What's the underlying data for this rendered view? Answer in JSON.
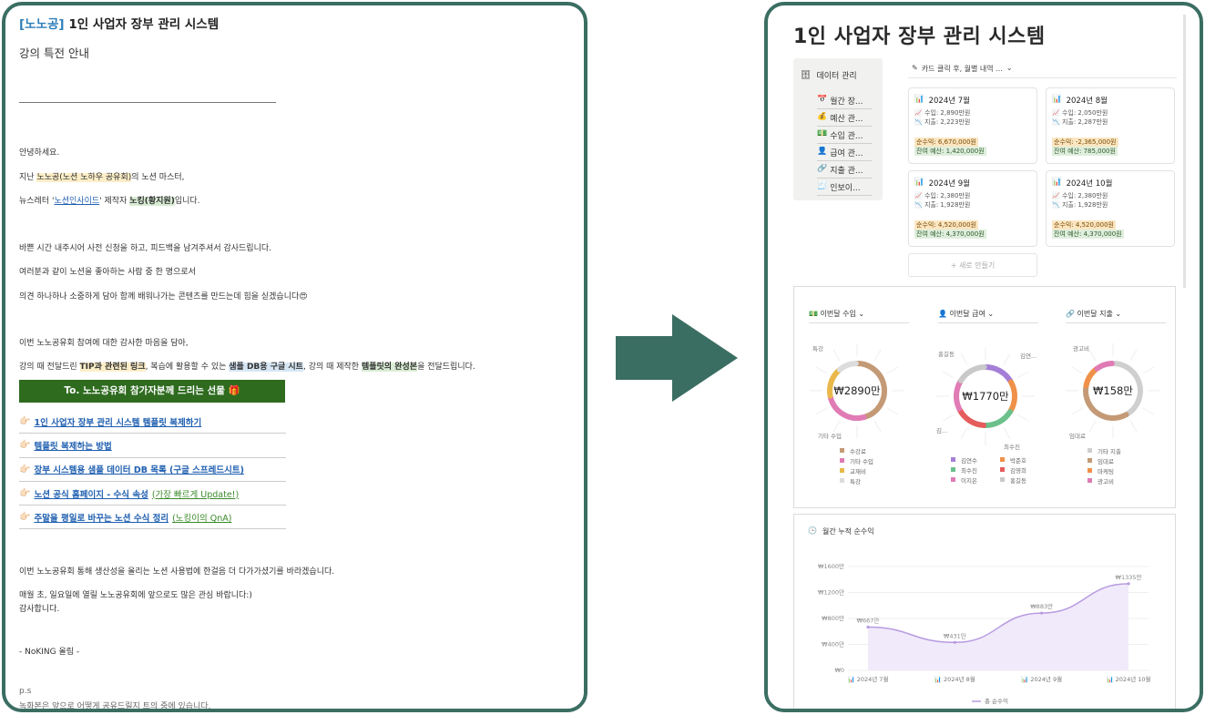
{
  "email": {
    "tag": "[노노공]",
    "title": "1인 사업자 장부 관리 시스템",
    "subtitle": "강의 특전 안내",
    "greeting": "안녕하세요.",
    "line1_pre": "지난 ",
    "line1_hl": "노노공(노션 노하우 공유회)",
    "line1_post": "의 노션 마스터,",
    "line2_pre": "뉴스레터 '",
    "line2_link": "노션인사이드",
    "line2_mid": "' 제작자 ",
    "line2_hl": "노킹(황지원)",
    "line2_post": "입니다.",
    "para1": "바쁜 시간 내주시어 사전 신청을 하고, 피드백을 남겨주셔서 감사드립니다.",
    "para2": "여러분과 같이 노션을 좋아하는 사람 중 한 명으로서",
    "para3": "의견 하나하나 소중하게 담아 함께 배워나가는 콘텐츠를 만드는데 힘을 싣겠습니다😍",
    "para4": "이번 노노공유회 참여에 대한 감사한 마음을 담아,",
    "para5_pre": "강의 때 전달드린 ",
    "para5_hl1": "TIP과 관련된 링크",
    "para5_mid1": ", 복습에 활용할 수 있는 ",
    "para5_hl2": "샘플 DB용 구글 시트",
    "para5_mid2": ", 강의 때 제작한 ",
    "para5_hl3": "템플릿의 완성본",
    "para5_post": "을 전달드립니다.",
    "gift_header": "To. 노노공유회 참가자분께 드리는 선물 🎁",
    "gifts": [
      {
        "label": "1인 사업자 장부 관리 시스템 템플릿 복제하기",
        "extra": ""
      },
      {
        "label": "템플릿 복제하는 방법",
        "extra": ""
      },
      {
        "label": "장부 시스템용 샘플 데이터 DB 목록 (구글 스프레드시트)",
        "extra": ""
      },
      {
        "label": "노션 공식 홈페이지 - 수식 속성",
        "extra": " (가장 빠르게 Update!)"
      },
      {
        "label": "주말을 평일로 바꾸는 노션 수식 정리",
        "extra": " (노킹이의 QnA)"
      }
    ],
    "closing1": "이번 노노공유회 통해 생산성을 올리는 노션 사용법에 한걸음 더 다가가셨기를 바라겠습니다.",
    "closing2": "매월 초, 일요일에 열릴 노노공유회에 앞으로도 많은 관심 바랍니다:)",
    "closing3": "감사합니다.",
    "sign": "- NoKING 올림 -",
    "ps": "p.s",
    "ps_text": "녹화본은 앞으로 어떻게 공유드릴지 트의 중에 있습니다."
  },
  "notion": {
    "title": "1인 사업자 장부 관리 시스템",
    "sidebar": {
      "header": "데이터 관리",
      "items": [
        {
          "icon": "📅",
          "label": "월간 장..."
        },
        {
          "icon": "💰",
          "label": "예산 관..."
        },
        {
          "icon": "💵",
          "label": "수입 관..."
        },
        {
          "icon": "👤",
          "label": "급여 관..."
        },
        {
          "icon": "🔗",
          "label": "지출 관..."
        },
        {
          "icon": "🧾",
          "label": "인보이..."
        }
      ]
    },
    "gallery_header": "카드 클릭 후, 월별 내역 ...",
    "cards": [
      {
        "month": "2024년 7월",
        "income": "수입: 2,890만원",
        "expense": "지출: 2,223만원",
        "net": "순수익: 6,670,000원",
        "budget": "잔여 예산: 1,420,000원"
      },
      {
        "month": "2024년 8월",
        "income": "수입: 2,050만원",
        "expense": "지출: 2,287만원",
        "net": "순수익: -2,365,000원",
        "budget": "잔여 예산: 785,000원"
      },
      {
        "month": "2024년 9월",
        "income": "수입: 2,380만원",
        "expense": "지출: 1,928만원",
        "net": "순수익: 4,520,000원",
        "budget": "잔여 예산: 4,370,000원"
      },
      {
        "month": "2024년 10월",
        "income": "수입: 2,380만원",
        "expense": "지출: 1,928만원",
        "net": "순수익: 4,520,000원",
        "budget": "잔여 예산: 4,370,000원"
      }
    ],
    "new_button": "+ 새로 만들기",
    "donuts": [
      {
        "header": "이번달 수입",
        "center": "₩2890만",
        "outer_labels": [
          "특강",
          "기타 수입"
        ],
        "legend": [
          {
            "label": "수강료",
            "color": "#c49a76",
            "value": 0.46
          },
          {
            "label": "기타 수입",
            "color": "#e07bb5",
            "value": 0.26
          },
          {
            "label": "교재비",
            "color": "#e9b84a",
            "value": 0.17
          },
          {
            "label": "특강",
            "color": "#dcdcdc",
            "value": 0.11
          }
        ]
      },
      {
        "header": "이번달 급여",
        "center": "₩1770만",
        "outer_labels": [
          "홍길동",
          "김연...",
          "최수진",
          "김..."
        ],
        "legend": [
          {
            "label": "김연수",
            "color": "#a47ed6",
            "value": 0.17
          },
          {
            "label": "박준호",
            "color": "#f0914a",
            "value": 0.17
          },
          {
            "label": "최수진",
            "color": "#6bc08b",
            "value": 0.17
          },
          {
            "label": "김영희",
            "color": "#e55c5c",
            "value": 0.17
          },
          {
            "label": "이지은",
            "color": "#e07bb5",
            "value": 0.16
          },
          {
            "label": "홍길동",
            "color": "#c9c9c9",
            "value": 0.16
          }
        ]
      },
      {
        "header": "이번달 지출",
        "center": "₩158만",
        "outer_labels": [
          "광고비",
          "임대료"
        ],
        "legend": [
          {
            "label": "기타 지출",
            "color": "#cfcfcf",
            "value": 0.42
          },
          {
            "label": "임대료",
            "color": "#c49a76",
            "value": 0.36
          },
          {
            "label": "마케팅",
            "color": "#f0914a",
            "value": 0.12
          },
          {
            "label": "광고비",
            "color": "#e07bb5",
            "value": 0.1
          }
        ]
      }
    ],
    "line_chart_title": "월간 누적 순수익"
  },
  "chart_data": {
    "type": "line",
    "title": "월간 누적 순수익",
    "categories": [
      "2024년 7월",
      "2024년 8월",
      "2024년 9월",
      "2024년 10월"
    ],
    "series": [
      {
        "name": "총 순수익",
        "values": [
          667,
          431,
          883,
          1335
        ],
        "labels": [
          "₩667만",
          "₩431만",
          "₩883만",
          "₩1335만"
        ]
      }
    ],
    "ylim": [
      0,
      1600
    ],
    "yticks": [
      "₩0",
      "₩400만",
      "₩800만",
      "₩1200만",
      "₩1600만"
    ],
    "grid": true,
    "legend": "bottom",
    "color": "#b79be0"
  }
}
